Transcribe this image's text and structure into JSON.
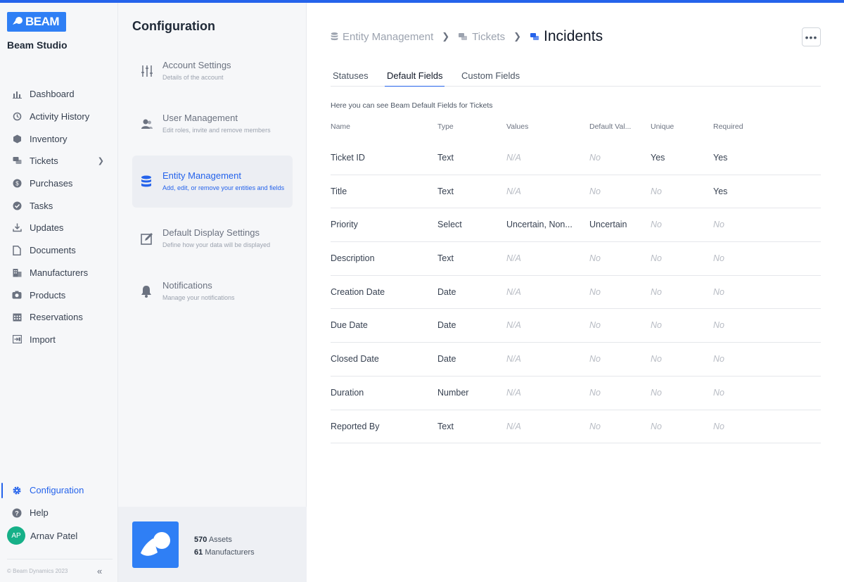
{
  "brand": {
    "logo_text": "BEAM",
    "studio": "Beam Studio",
    "accent": "#2563eb",
    "copyright": "© Beam Dynamics 2023"
  },
  "sidebar": {
    "items": [
      {
        "label": "Dashboard",
        "icon": "bar-chart-icon"
      },
      {
        "label": "Activity History",
        "icon": "history-icon"
      },
      {
        "label": "Inventory",
        "icon": "cube-icon"
      },
      {
        "label": "Tickets",
        "icon": "tickets-icon"
      },
      {
        "label": "Purchases",
        "icon": "dollar-badge-icon"
      },
      {
        "label": "Tasks",
        "icon": "check-circle-icon"
      },
      {
        "label": "Updates",
        "icon": "download-icon"
      },
      {
        "label": "Documents",
        "icon": "document-icon"
      },
      {
        "label": "Manufacturers",
        "icon": "building-icon"
      },
      {
        "label": "Products",
        "icon": "camera-icon"
      },
      {
        "label": "Reservations",
        "icon": "calendar-icon"
      },
      {
        "label": "Import",
        "icon": "import-icon"
      }
    ],
    "configuration": "Configuration",
    "help": "Help",
    "user": {
      "initials": "AP",
      "name": "Arnav Patel"
    }
  },
  "config": {
    "title": "Configuration",
    "items": [
      {
        "label": "Account Settings",
        "desc": "Details of the account"
      },
      {
        "label": "User Management",
        "desc": "Edit roles, invite and remove members"
      },
      {
        "label": "Entity Management",
        "desc": "Add, edit, or remove your entities and fields"
      },
      {
        "label": "Default Display Settings",
        "desc": "Define how your data will be displayed"
      },
      {
        "label": "Notifications",
        "desc": "Manage your notifications"
      }
    ],
    "stats": {
      "assets_count": "570",
      "assets_label": "Assets",
      "manufacturers_count": "61",
      "manufacturers_label": "Manufacturers"
    }
  },
  "main": {
    "breadcrumb": [
      "Entity Management",
      "Tickets",
      "Incidents"
    ],
    "more": "•••",
    "tabs": [
      "Statuses",
      "Default Fields",
      "Custom Fields"
    ],
    "intro": "Here you can see Beam Default Fields for Tickets",
    "columns": [
      "Name",
      "Type",
      "Values",
      "Default Val...",
      "Unique",
      "Required"
    ],
    "rows": [
      {
        "name": "Ticket ID",
        "type": "Text",
        "values": "N/A",
        "default": "No",
        "unique": "Yes",
        "required": "Yes"
      },
      {
        "name": "Title",
        "type": "Text",
        "values": "N/A",
        "default": "No",
        "unique": "No",
        "required": "Yes"
      },
      {
        "name": "Priority",
        "type": "Select",
        "values": "Uncertain, Non...",
        "default": "Uncertain",
        "unique": "No",
        "required": "No"
      },
      {
        "name": "Description",
        "type": "Text",
        "values": "N/A",
        "default": "No",
        "unique": "No",
        "required": "No"
      },
      {
        "name": "Creation Date",
        "type": "Date",
        "values": "N/A",
        "default": "No",
        "unique": "No",
        "required": "No"
      },
      {
        "name": "Due Date",
        "type": "Date",
        "values": "N/A",
        "default": "No",
        "unique": "No",
        "required": "No"
      },
      {
        "name": "Closed Date",
        "type": "Date",
        "values": "N/A",
        "default": "No",
        "unique": "No",
        "required": "No"
      },
      {
        "name": "Duration",
        "type": "Number",
        "values": "N/A",
        "default": "No",
        "unique": "No",
        "required": "No"
      },
      {
        "name": "Reported By",
        "type": "Text",
        "values": "N/A",
        "default": "No",
        "unique": "No",
        "required": "No"
      }
    ]
  }
}
